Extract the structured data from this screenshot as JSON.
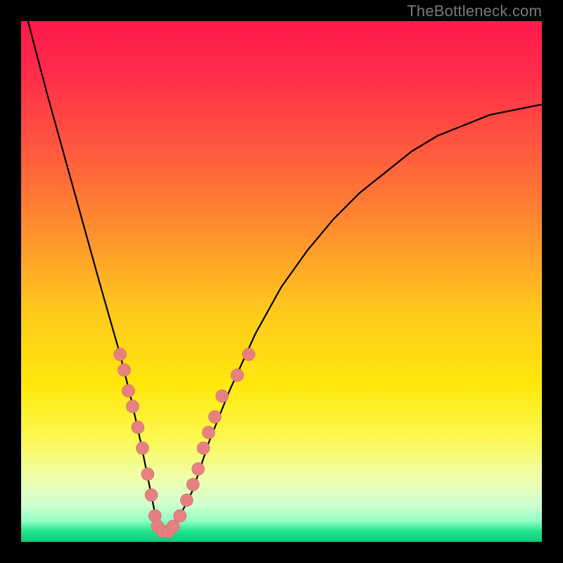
{
  "watermark": "TheBottleneck.com",
  "colors": {
    "frame": "#000000",
    "gradient_top": "#ff1a4b",
    "gradient_bottom": "#0ec97c",
    "curve": "#000000",
    "dot_fill": "#e78181",
    "dot_stroke": "#d06868"
  },
  "chart_data": {
    "type": "line",
    "title": "",
    "xlabel": "",
    "ylabel": "",
    "xlim": [
      0,
      100
    ],
    "ylim": [
      0,
      100
    ],
    "series": [
      {
        "name": "bottleneck-curve",
        "x": [
          0,
          5,
          10,
          15,
          17,
          19,
          21,
          23,
          25,
          26,
          27,
          28,
          30,
          33,
          36,
          40,
          45,
          50,
          55,
          60,
          65,
          70,
          75,
          80,
          85,
          90,
          95,
          100
        ],
        "y": [
          105,
          86,
          68,
          50,
          43,
          36,
          28,
          19,
          9,
          4,
          2,
          2,
          4,
          10,
          19,
          29,
          40,
          49,
          56,
          62,
          67,
          71,
          75,
          78,
          80,
          82,
          83,
          84
        ]
      }
    ],
    "points": {
      "name": "sample-dots",
      "coords": [
        [
          19.0,
          36
        ],
        [
          19.8,
          33
        ],
        [
          20.6,
          29
        ],
        [
          21.4,
          26
        ],
        [
          22.4,
          22
        ],
        [
          23.3,
          18
        ],
        [
          24.3,
          13
        ],
        [
          25.0,
          9
        ],
        [
          25.7,
          5
        ],
        [
          26.2,
          3
        ],
        [
          27.2,
          2
        ],
        [
          28.3,
          2
        ],
        [
          29.2,
          3
        ],
        [
          30.5,
          5
        ],
        [
          31.8,
          8
        ],
        [
          33.0,
          11
        ],
        [
          34.0,
          14
        ],
        [
          35.0,
          18
        ],
        [
          36.0,
          21
        ],
        [
          37.2,
          24
        ],
        [
          38.6,
          28
        ],
        [
          41.5,
          32
        ],
        [
          43.7,
          36
        ]
      ],
      "radius": 9
    }
  }
}
